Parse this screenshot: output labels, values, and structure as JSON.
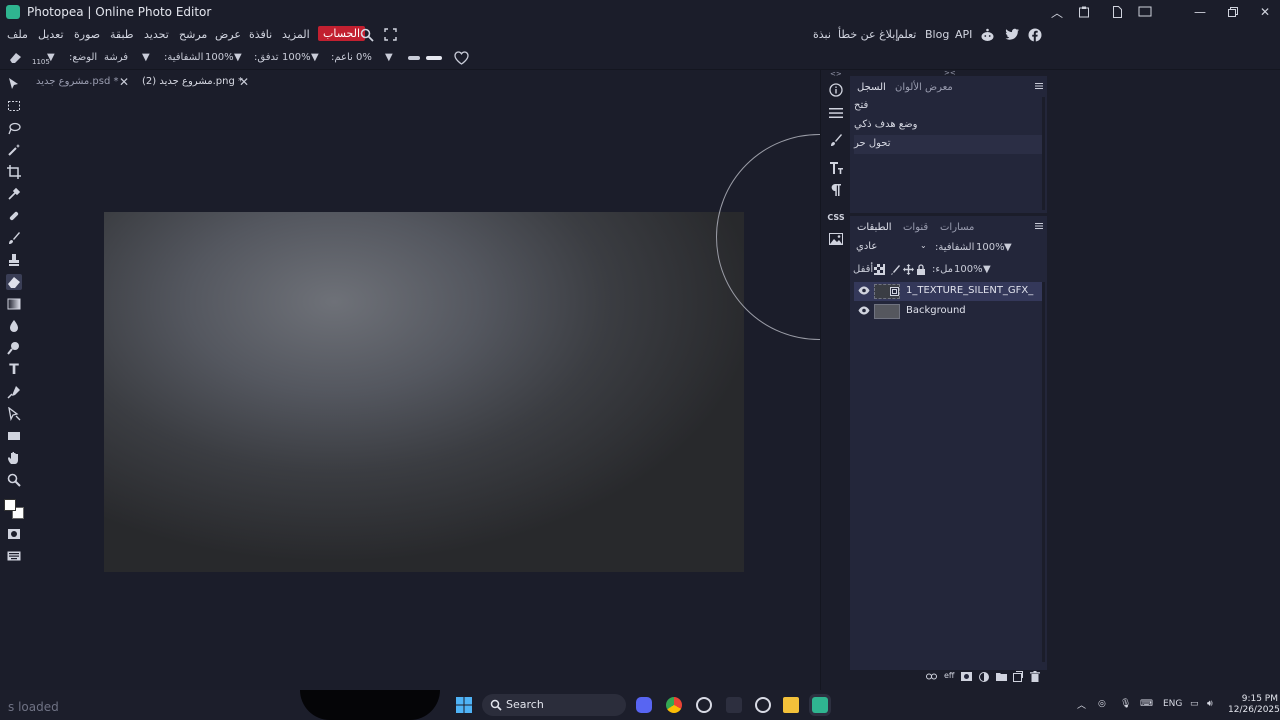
{
  "window": {
    "title": "Photopea | Online Photo Editor"
  },
  "menu": {
    "file": "ملف",
    "edit": "تعديل",
    "image": "صورة",
    "layer": "طبقة",
    "select": "تحديد",
    "filter": "مرشح",
    "view": "عرض",
    "window": "نافذة",
    "more": "المزيد",
    "account": "الحساب",
    "about": "نبذة",
    "report_bug": "إبلاغ عن خطأ",
    "learn": "تعلم",
    "blog": "Blog",
    "api": "API"
  },
  "options": {
    "size": "1105",
    "brush_label": "فرشة",
    "mode_label": ":الوضع",
    "opacity_label": ":الشفافية",
    "opacity_value": "100%",
    "flow_label": ":تدفق",
    "flow_value": "100%",
    "smooth_label": ":ناعم",
    "smooth_value": "0%"
  },
  "tabs": [
    {
      "label": "مشروع جديد.psd *"
    },
    {
      "label": "مشروع جديد (2).png *"
    }
  ],
  "history_panel": {
    "tabs": [
      "السجل",
      "معرض الألوان"
    ],
    "items": [
      "فتح",
      "وضع هدف ذكي",
      "تحول حر"
    ]
  },
  "layers_panel": {
    "tabs": [
      "الطبقات",
      "قنوات",
      "مسارات"
    ],
    "blend_mode": "عادي",
    "opacity_label": ":الشفافية",
    "opacity_value": "100%",
    "lock_label": "أقفل",
    "fill_label": ":ملء",
    "fill_value": "100%",
    "layers": [
      {
        "name": "1_TEXTURE_SILENT_GFX_"
      },
      {
        "name": "Background"
      }
    ]
  },
  "right_icons": {
    "css_label": "CSS"
  },
  "taskbar": {
    "status": "s loaded",
    "search": "Search",
    "lang": "ENG",
    "time": "9:15 PM",
    "date": "12/26/2025"
  },
  "colors": {
    "accent_red": "#c22030",
    "canvas_light": "#6e7178",
    "panel_bg": "#23263a"
  }
}
